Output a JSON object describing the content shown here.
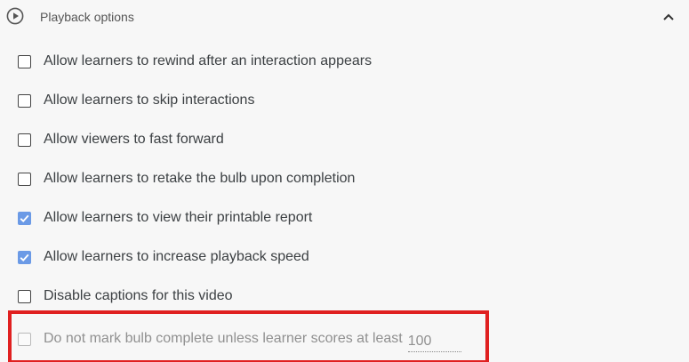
{
  "header": {
    "title": "Playback options",
    "play_icon": "play-circle-icon",
    "collapse_icon": "chevron-up-icon"
  },
  "colors": {
    "checked": "#6b9ae6",
    "highlight": "#e02020"
  },
  "options": [
    {
      "label": "Allow learners to rewind after an interaction appears",
      "checked": false
    },
    {
      "label": "Allow learners to skip interactions",
      "checked": false
    },
    {
      "label": "Allow viewers to fast forward",
      "checked": false
    },
    {
      "label": "Allow learners to retake the bulb upon completion",
      "checked": false
    },
    {
      "label": "Allow learners to view their printable report",
      "checked": true
    },
    {
      "label": "Allow learners to increase playback speed",
      "checked": true
    },
    {
      "label": "Disable captions for this video",
      "checked": false
    }
  ],
  "score_option": {
    "label": "Do not mark bulb complete unless learner scores at least",
    "checked": false,
    "value": "100"
  }
}
